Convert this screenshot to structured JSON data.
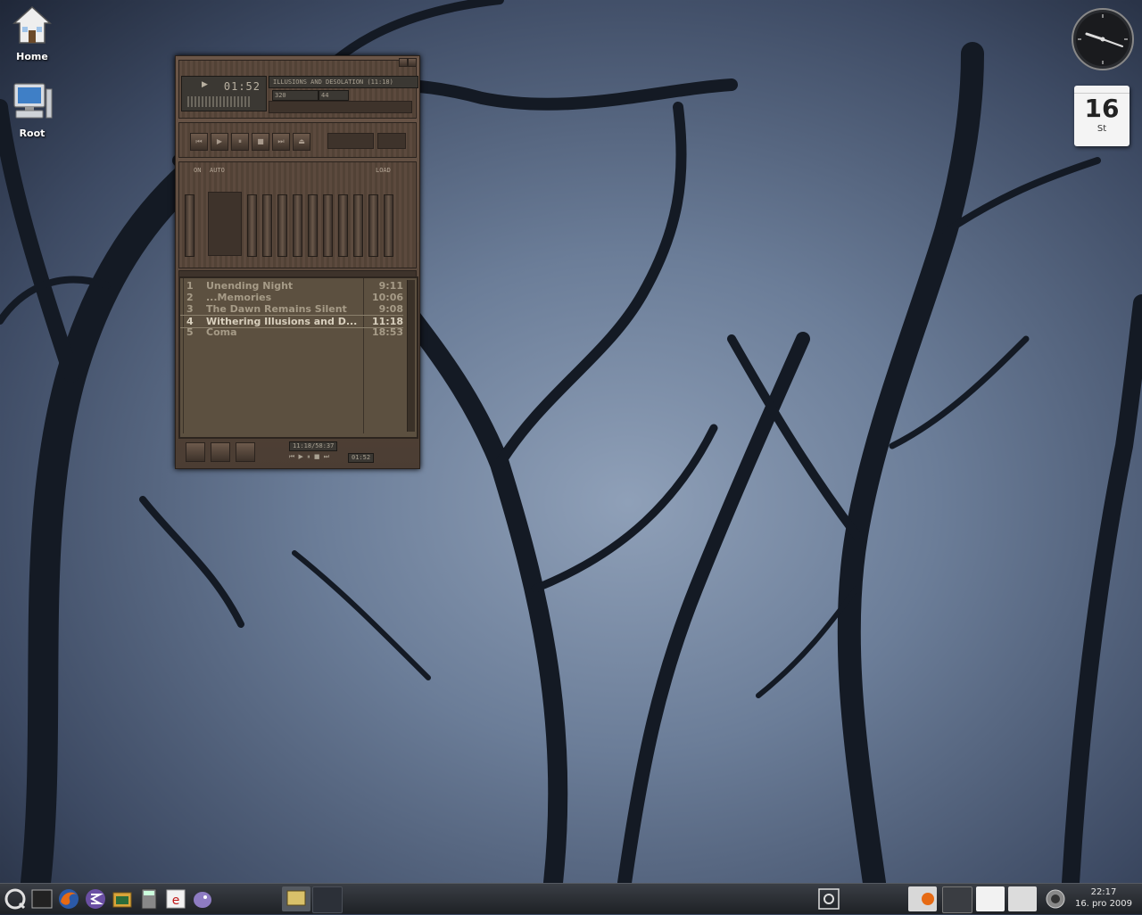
{
  "desktop": {
    "icons": [
      {
        "label": "Home",
        "icon": "home-icon"
      },
      {
        "label": "Root",
        "icon": "computer-icon"
      }
    ]
  },
  "widgets": {
    "calendar": {
      "day": "16",
      "weekday": "St"
    }
  },
  "player": {
    "time": "01:52",
    "marquee": "ILLUSIONS AND DESOLATION (11:18)",
    "kbps": "320",
    "khz": "44",
    "eq_on": "ON",
    "eq_auto": "AUTO",
    "eq_load": "LOAD",
    "playlist_total": "11:18/58:37",
    "playlist_time": "01:52"
  },
  "playlist": {
    "current_index": 3,
    "tracks": [
      {
        "num": "1",
        "title": "Unending Night",
        "duration": "9:11"
      },
      {
        "num": "2",
        "title": "...Memories",
        "duration": "10:06"
      },
      {
        "num": "3",
        "title": "The Dawn Remains Silent",
        "duration": "9:08"
      },
      {
        "num": "4",
        "title": "Withering Illusions and D...",
        "duration": "11:18"
      },
      {
        "num": "5",
        "title": "Coma",
        "duration": "18:53"
      }
    ]
  },
  "taskbar": {
    "launchers": [
      "kde-menu-icon",
      "terminal-icon",
      "firefox-icon",
      "emacs-icon",
      "file-manager-icon",
      "calculator-icon",
      "editor-icon",
      "pidgin-icon"
    ],
    "clock_time": "22:17",
    "clock_date": "16. pro 2009"
  }
}
